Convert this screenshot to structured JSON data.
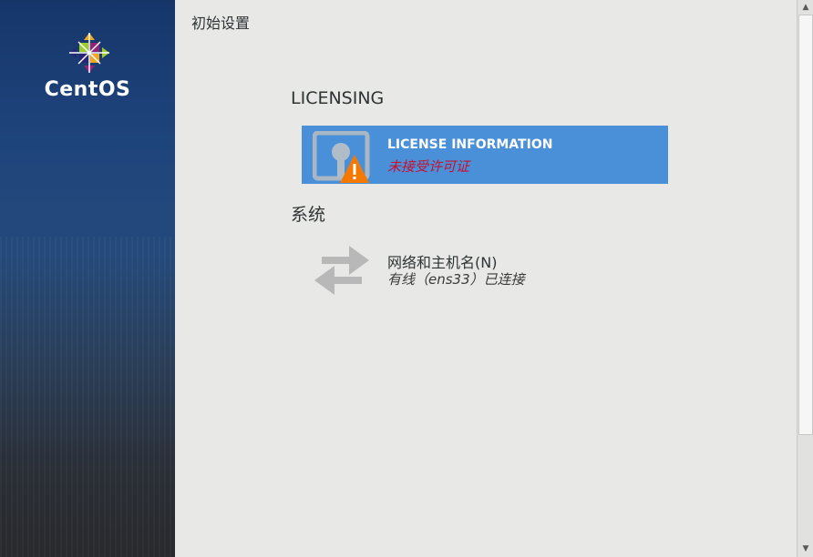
{
  "sidebar": {
    "brand": "CentOS"
  },
  "main": {
    "title": "初始设置",
    "sections": [
      {
        "title": "LICENSING",
        "spokes": [
          {
            "title": "LICENSE INFORMATION",
            "status": "未接受许可证",
            "icon": "license-warning-icon",
            "selected": true
          }
        ]
      },
      {
        "title": "系统",
        "spokes": [
          {
            "title": "网络和主机名(N)",
            "status": "有线（ens33）已连接",
            "icon": "network-arrows-icon",
            "selected": false
          }
        ]
      }
    ]
  },
  "colors": {
    "selected_bg": "#4a90d9",
    "warning_text": "#c8102e",
    "warning_icon": "#f57900"
  },
  "scrollbar": {
    "up": "▲",
    "down": "▼"
  }
}
